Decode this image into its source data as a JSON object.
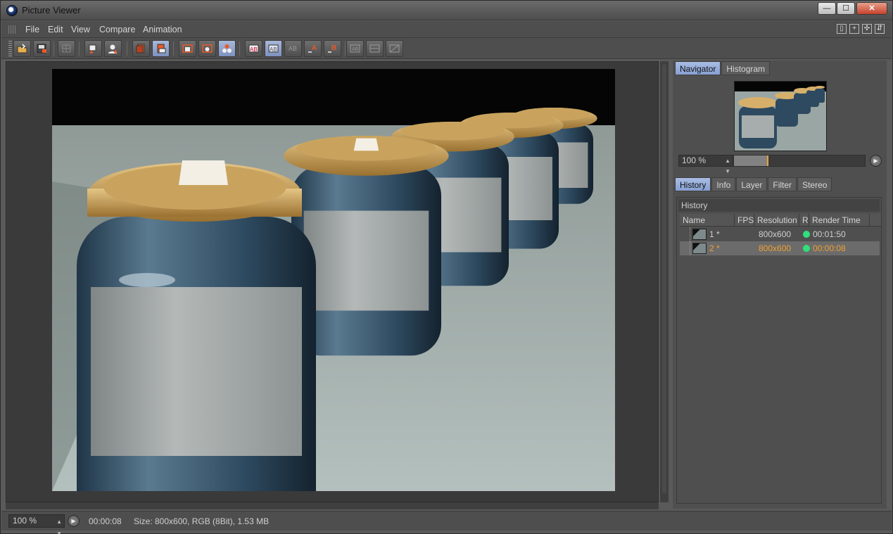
{
  "window": {
    "title": "Picture Viewer",
    "min": "—",
    "max": "☐",
    "close": "✕"
  },
  "menu": {
    "file": "File",
    "edit": "Edit",
    "view": "View",
    "compare": "Compare",
    "animation": "Animation"
  },
  "toolbar_icons": [
    "open-icon",
    "save-icon",
    "grid-icon",
    "export-icon",
    "user-icon",
    "stack-icon",
    "layers-icon",
    "region-render-icon",
    "region-select-icon",
    "region-group-icon",
    "ab-compare-icon",
    "ab-split-icon",
    "ab-overlay-icon",
    "set-a-icon",
    "set-b-icon",
    "split-horizontal-icon",
    "split-vertical-icon",
    "split-diagonal-icon"
  ],
  "right_panel": {
    "nav_tabs": [
      "Navigator",
      "Histogram"
    ],
    "zoom_value": "100 %",
    "zoom_slider_fraction": 0.25,
    "info_tabs": [
      "History",
      "Info",
      "Layer",
      "Filter",
      "Stereo"
    ],
    "history_heading": "History",
    "columns": [
      "Name",
      "FPS",
      "Resolution",
      "R",
      "Render Time"
    ],
    "rows": [
      {
        "name": "1 *",
        "resolution": "800x600",
        "time": "00:01:50"
      },
      {
        "name": "2 *",
        "resolution": "800x600",
        "time": "00:00:08"
      }
    ]
  },
  "status": {
    "zoom": "100 %",
    "time": "00:00:08",
    "info": "Size: 800x600, RGB (8Bit), 1.53 MB"
  },
  "colors": {
    "accent_tab": "#9db3e0",
    "selected_text": "#f0a030",
    "status_dot": "#2fe07a"
  }
}
